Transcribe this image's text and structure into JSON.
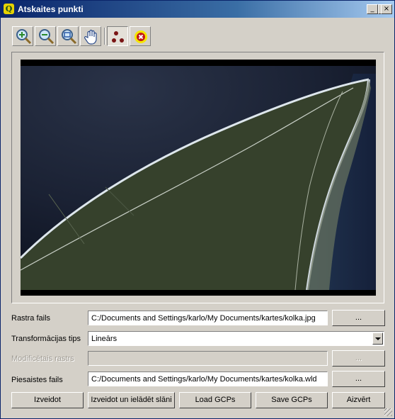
{
  "window": {
    "title": "Atskaites punkti",
    "app_icon": "Q"
  },
  "title_buttons": {
    "minimize": "_",
    "maximize": "□",
    "close": "×"
  },
  "toolbar": {
    "tools": [
      {
        "name": "zoom-in-icon"
      },
      {
        "name": "zoom-out-icon"
      },
      {
        "name": "zoom-full-icon"
      },
      {
        "name": "pan-hand-icon"
      },
      {
        "name": "add-point-icon"
      },
      {
        "name": "delete-point-icon"
      }
    ]
  },
  "form": {
    "raster_label": "Rastra fails",
    "raster_value": "C:/Documents and Settings/karlo/My Documents/kartes/kolka.jpg",
    "raster_browse": "...",
    "transform_label": "Transformācijas tips",
    "transform_value": "Lineārs",
    "modified_label": "Modificētais rastrs",
    "modified_value": "",
    "modified_browse": "...",
    "world_label": "Piesaistes fails",
    "world_value": "C:/Documents and Settings/karlo/My Documents/kartes/kolka.wld",
    "world_browse": "..."
  },
  "buttons": {
    "create": "Izveidot",
    "create_load": "Izveidot un ielādēt slāni",
    "load_gcps": "Load GCPs",
    "save_gcps": "Save GCPs",
    "close": "Aizvērt"
  },
  "colors": {
    "titlebar_start": "#0a246a",
    "window_bg": "#d4d0c8",
    "sea": "#1c2436",
    "land": "#38432d"
  }
}
